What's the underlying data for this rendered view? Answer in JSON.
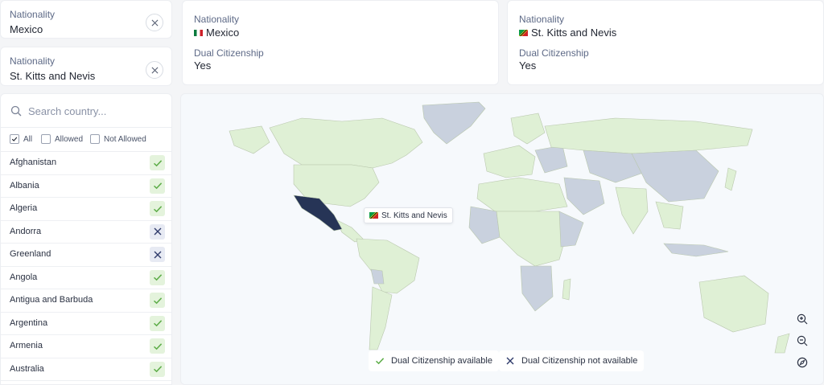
{
  "nationality_cards": [
    {
      "label": "Nationality",
      "value": "Mexico"
    },
    {
      "label": "Nationality",
      "value": "St. Kitts and Nevis"
    }
  ],
  "search": {
    "placeholder": "Search country..."
  },
  "filters": [
    {
      "label": "All",
      "checked": true
    },
    {
      "label": "Allowed",
      "checked": false
    },
    {
      "label": "Not Allowed",
      "checked": false
    }
  ],
  "countries": [
    {
      "name": "Afghanistan",
      "allowed": true
    },
    {
      "name": "Albania",
      "allowed": true
    },
    {
      "name": "Algeria",
      "allowed": true
    },
    {
      "name": "Andorra",
      "allowed": false
    },
    {
      "name": "Greenland",
      "allowed": false
    },
    {
      "name": "Angola",
      "allowed": true
    },
    {
      "name": "Antigua and Barbuda",
      "allowed": true
    },
    {
      "name": "Argentina",
      "allowed": true
    },
    {
      "name": "Armenia",
      "allowed": true
    },
    {
      "name": "Australia",
      "allowed": true
    }
  ],
  "info_cards": [
    {
      "nat_label": "Nationality",
      "nat_value": "Mexico",
      "flag": "mexico-flag",
      "dual_label": "Dual Citizenship",
      "dual_value": "Yes"
    },
    {
      "nat_label": "Nationality",
      "nat_value": "St. Kitts and Nevis",
      "flag": "st-kitts-nevis-flag",
      "dual_label": "Dual Citizenship",
      "dual_value": "Yes"
    }
  ],
  "map": {
    "tooltip": "St. Kitts and Nevis",
    "legend": {
      "available": "Dual Citizenship available",
      "not_available": "Dual Citizenship not available"
    }
  },
  "colors": {
    "allowed_fill": "#dff0d5",
    "not_allowed_fill": "#c9d1de",
    "selected_fill": "#263456",
    "check": "#5fae4a",
    "cross": "#2f3b6b",
    "ocean": "#f6f9fc"
  }
}
